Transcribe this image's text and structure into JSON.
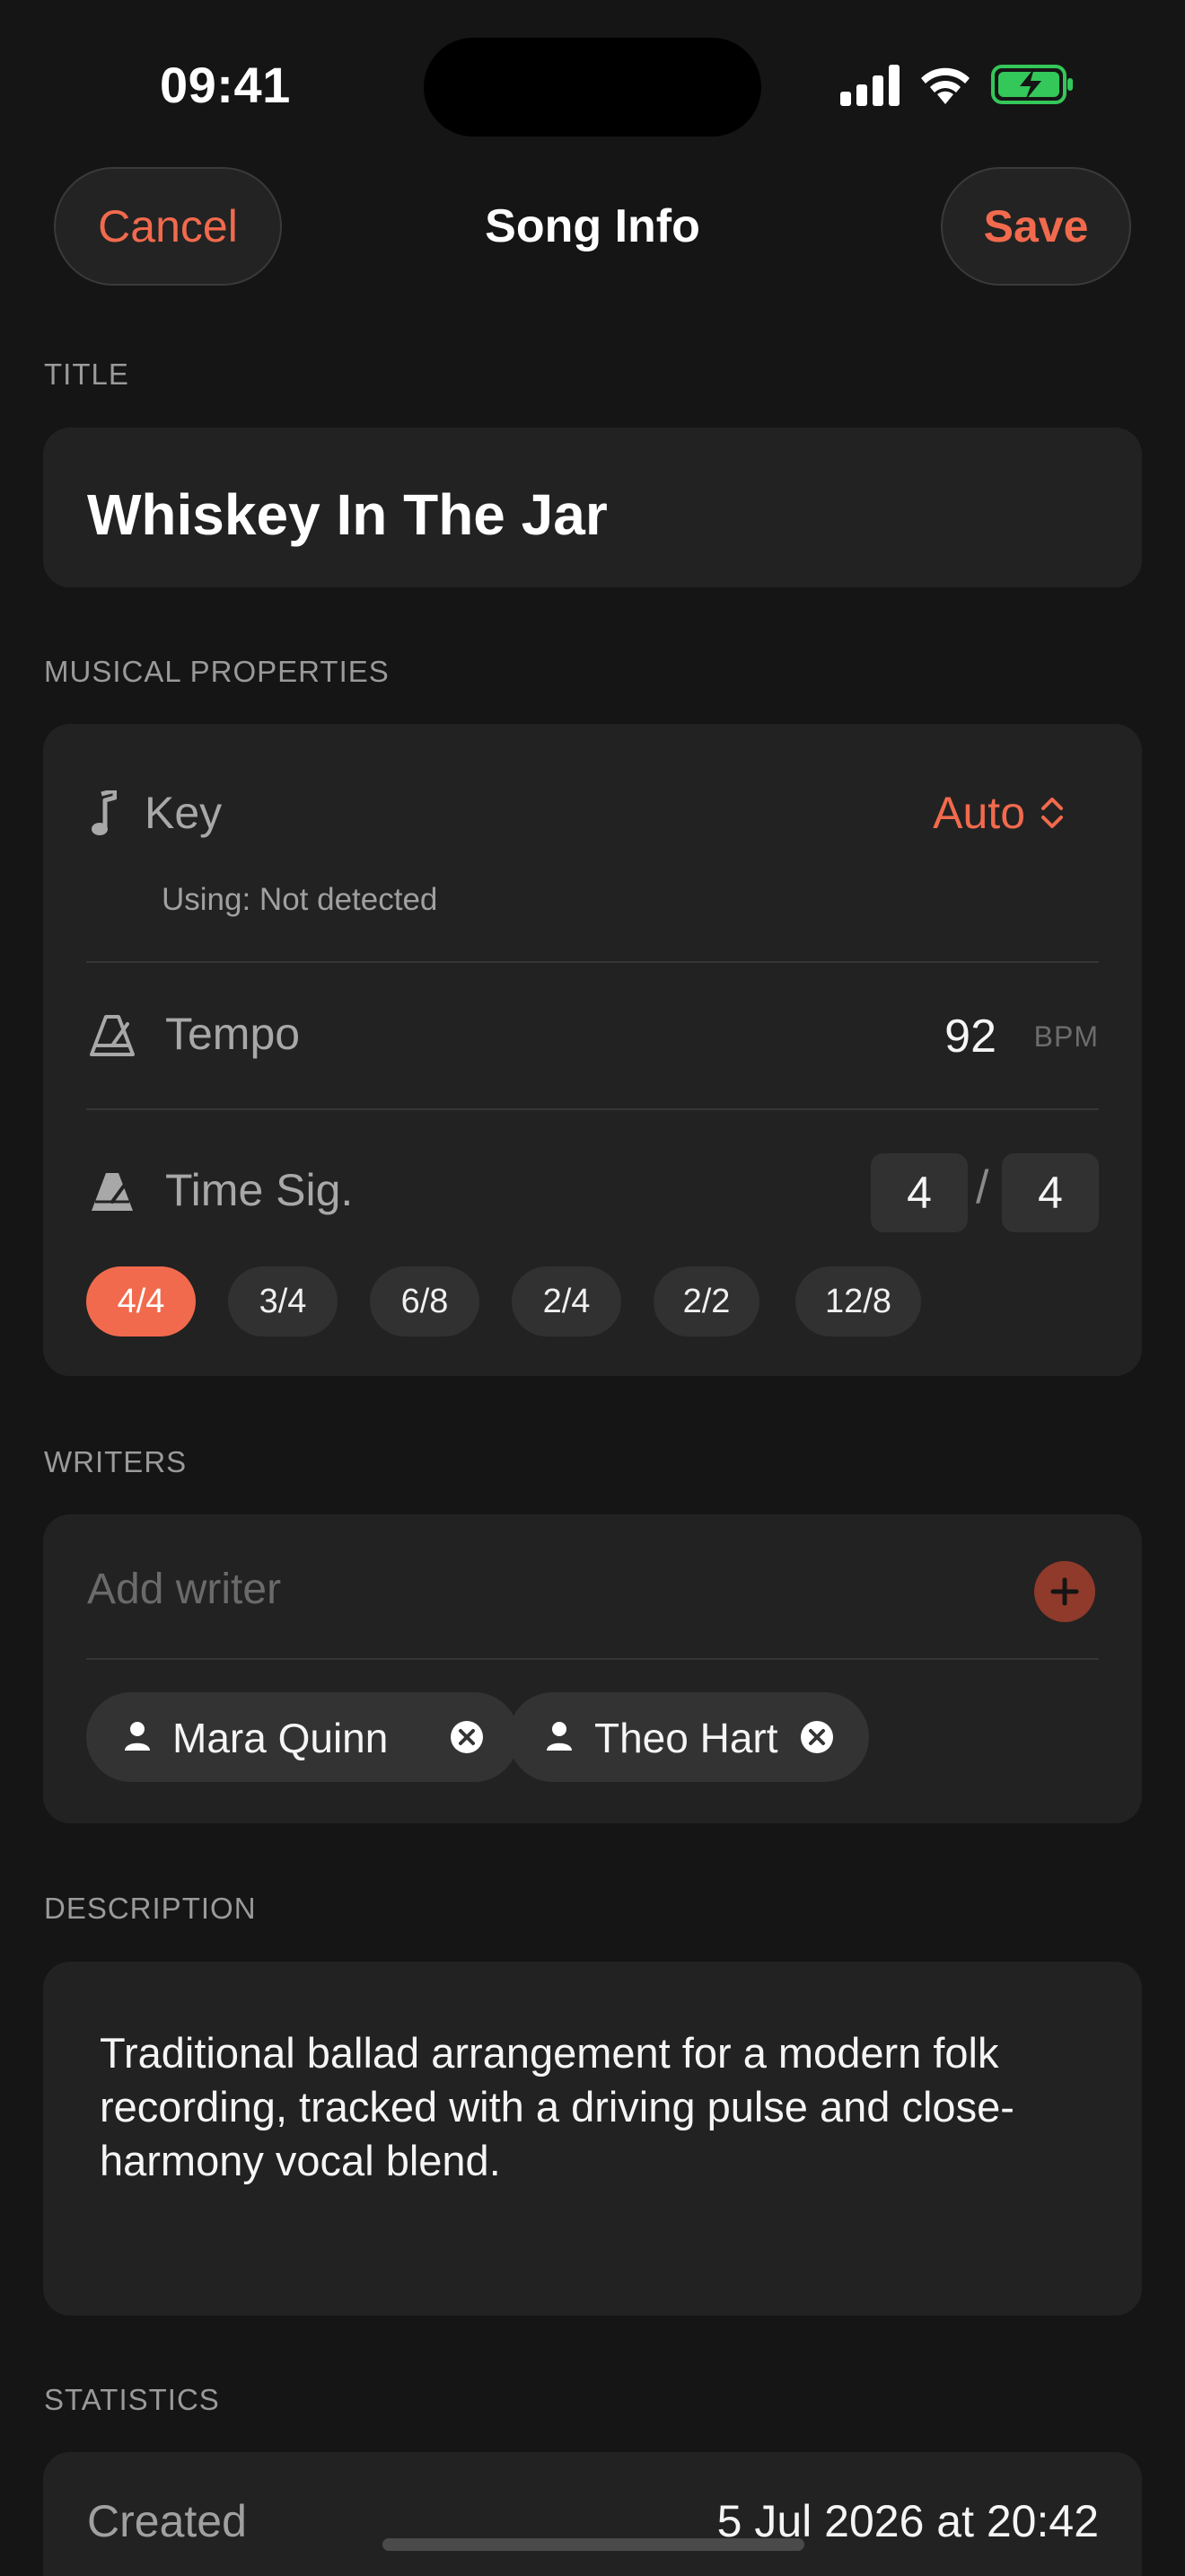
{
  "status_bar": {
    "time": "09:41"
  },
  "header": {
    "cancel_label": "Cancel",
    "title": "Song Info",
    "save_label": "Save"
  },
  "sections": {
    "title": "TITLE",
    "musical": "MUSICAL PROPERTIES",
    "writers": "WRITERS",
    "description": "DESCRIPTION",
    "statistics": "STATISTICS"
  },
  "song": {
    "title": "Whiskey In The Jar"
  },
  "musical": {
    "key_label": "Key",
    "key_value": "Auto",
    "key_sub": "Using: Not detected",
    "tempo_label": "Tempo",
    "tempo_value": "92",
    "tempo_unit": "BPM",
    "timesig_label": "Time Sig.",
    "timesig_top": "4",
    "timesig_slash": "/",
    "timesig_bottom": "4",
    "presets": [
      "4/4",
      "3/4",
      "6/8",
      "2/4",
      "2/2",
      "12/8"
    ],
    "selected_preset": "4/4"
  },
  "writers": {
    "placeholder": "Add writer",
    "list": [
      {
        "name": "Mara Quinn"
      },
      {
        "name": "Theo Hart"
      }
    ]
  },
  "description": {
    "text": "Traditional ballad arrangement for a modern folk recording, tracked with a driving pulse and close-harmony vocal blend."
  },
  "statistics": {
    "created_label": "Created",
    "created_value": "5 Jul 2026 at 20:42"
  },
  "colors": {
    "accent": "#f26a4d",
    "background": "#151515",
    "card": "#222222",
    "battery": "#34c759"
  }
}
